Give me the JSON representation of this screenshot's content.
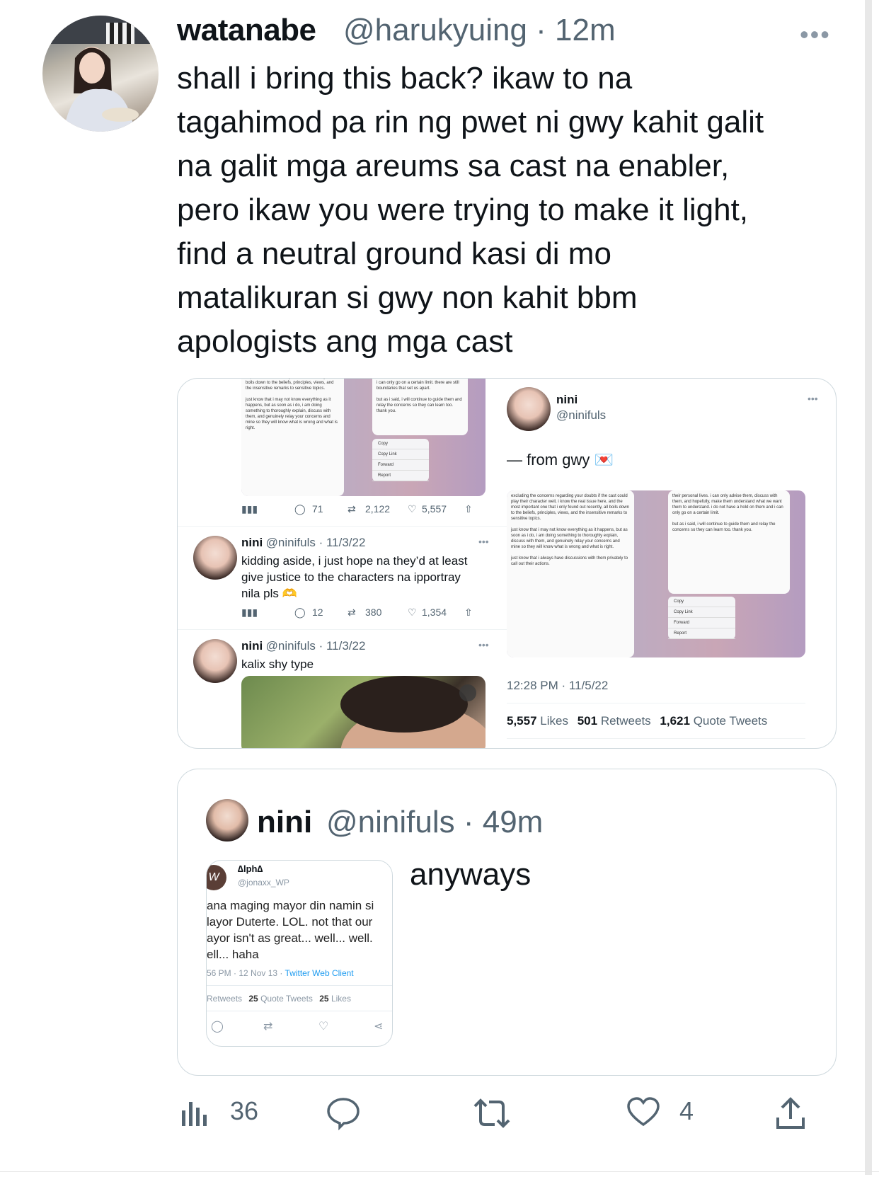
{
  "tweet": {
    "display_name": "watanabe",
    "handle_time": "@harukyuing · 12m",
    "more_icon": "more-horizontal-icon",
    "text": "shall i bring this back? ikaw to na\ntagahimod pa rin ng pwet ni gwy kahit galit\nna galit mga areums sa cast na enabler,\npero ikaw you were trying to make it light,\nfind a neutral ground kasi di mo\nmatalikuran si gwy non kahit bbm\napologists ang mga cast"
  },
  "media": {
    "left_panel": {
      "top_stats": {
        "replies": "71",
        "retweets": "2,122",
        "likes": "5,557"
      },
      "replies": [
        {
          "name": "nini",
          "handle_date": "@ninifuls · 11/3/22",
          "text": "kidding aside, i just hope na they’d at least give justice to the characters na ipportray nila pls 🫶",
          "replies": "12",
          "retweets": "380",
          "likes": "1,354"
        },
        {
          "name": "nini",
          "handle_date": "@ninifuls · 11/3/22",
          "text": "kalix shy type"
        }
      ],
      "menu": [
        "Copy",
        "Copy Link",
        "Forward",
        "Report"
      ]
    },
    "right_panel": {
      "name": "nini",
      "handle": "@ninifuls",
      "text": "— from gwy 💌",
      "timestamp": "12:28 PM · 11/5/22",
      "likes_count": "5,557",
      "likes_label": "Likes",
      "retweets_count": "501",
      "retweets_label": "Retweets",
      "quotes_count": "1,621",
      "quotes_label": "Quote Tweets",
      "menu": [
        "Copy",
        "Copy Link",
        "Forward",
        "Report"
      ]
    }
  },
  "quote": {
    "name": "nini",
    "handle_time": "@ninifuls · 49m",
    "text": "anyways",
    "card": {
      "name": "∆lph∆",
      "handle": "@jonaxx_WP",
      "text": "ana maging mayor din namin si\nlayor Duterte. LOL. not that our\nayor isn't as great... well... well.\nell... haha",
      "meta": "56 PM · 12 Nov 13 · ",
      "client": "Twitter Web Client",
      "stats_a": "Retweets",
      "quotes_n": "25",
      "quotes_l": "Quote Tweets",
      "likes_n": "25",
      "likes_l": "Likes"
    }
  },
  "actions": {
    "views": "36",
    "likes": "4"
  }
}
